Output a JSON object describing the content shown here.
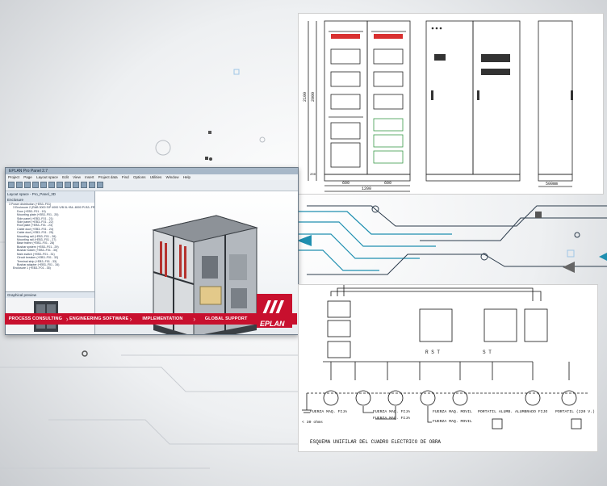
{
  "eplan_window": {
    "title": "EPLAN Pro Panel 2.7",
    "menu": [
      "Project",
      "Page",
      "Layout space",
      "Edit",
      "View",
      "Insert",
      "Project data",
      "Find",
      "Options",
      "Utilities",
      "Window",
      "Help"
    ],
    "tree_header": "Layout space - Pro_Panel_3D",
    "tree_items": [
      {
        "label": "3 Power distribution (+EB3-.F01)",
        "level": 1
      },
      {
        "label": "3 Enclosure 2 (RAB 3000 S/P 4000 V/B 0L+B4-.8000 P/.B3-.FRT)",
        "level": 2
      },
      {
        "label": "Door (+EB3-.F01 - 19)",
        "level": 3
      },
      {
        "label": "Mounting plate (+EB3-.F01 - 20)",
        "level": 3
      },
      {
        "label": "Side panel (+EB3-.F01 - 21)",
        "level": 3
      },
      {
        "label": "Side panel (+EB3-.F01 - 22)",
        "level": 3
      },
      {
        "label": "Roof plate (+EB3-.F01 - 23)",
        "level": 3
      },
      {
        "label": "Cable duct (+EB3-.F01 - 24)",
        "level": 3
      },
      {
        "label": "Cable duct (+EB3-.F01 - 25)",
        "level": 3
      },
      {
        "label": "Mounting rail (+EB3-.F01 - 26)",
        "level": 3
      },
      {
        "label": "Mounting rail (+EB3-.F01 - 27)",
        "level": 3
      },
      {
        "label": "Base frame (+EB3-.F01 - 28)",
        "level": 3
      },
      {
        "label": "Busbar system (+EB3-.F01 - 29)",
        "level": 3
      },
      {
        "label": "Busbar holder (+EB3-.F01 - 30)",
        "level": 3
      },
      {
        "label": "Main switch (+EB3-.F01 - 31)",
        "level": 3
      },
      {
        "label": "Circuit breaker (+EB3-.F01 - 32)",
        "level": 3
      },
      {
        "label": "Terminal strip (+EB3-.F01 - 33)",
        "level": 3
      },
      {
        "label": "Busbar adapter (+EB3-.F01 - 34)",
        "level": 3
      },
      {
        "label": "Enclosure 1 (+EB3-.F01 - 35)",
        "level": 2
      }
    ],
    "navigator_label": "Enclosure",
    "thumbnail_header": "Graphical preview"
  },
  "phase_bar": [
    "PROCESS CONSULTING",
    "ENGINEERING SOFTWARE",
    "IMPLEMENTATION",
    "GLOBAL SUPPORT"
  ],
  "logo_text": "EPLAN",
  "panel_drawing": {
    "dim_2100": "2100",
    "dim_2000": "2000",
    "dim_200": "200",
    "dim_600_a": "600",
    "dim_600_b": "600",
    "dim_1200": "1200",
    "dim_500": "500mm"
  },
  "schematic": {
    "caption": "ESQUEMA UNIFILAR DEL CUADRO ELECTRICO DE OBRA",
    "ground_note": "< 30 ohms",
    "phase_labels_1": "R S T",
    "phase_labels_2": "S T",
    "labels": [
      "FUERZA MAQ. FIJA",
      "FUERZA MAQ. FIJA",
      "FUERZA MAQ. FIJA",
      "FUERZA MAQ. MOVIL",
      "FUERZA MAQ. MOVIL",
      "PORTATIL ALUMB.",
      "ALUMBRADO FIJO",
      "PORTATIL (220 V.)"
    ]
  },
  "colors": {
    "brand_red": "#c8102e",
    "circuit_teal": "#1f8fb0",
    "cad_ink": "#111111"
  }
}
